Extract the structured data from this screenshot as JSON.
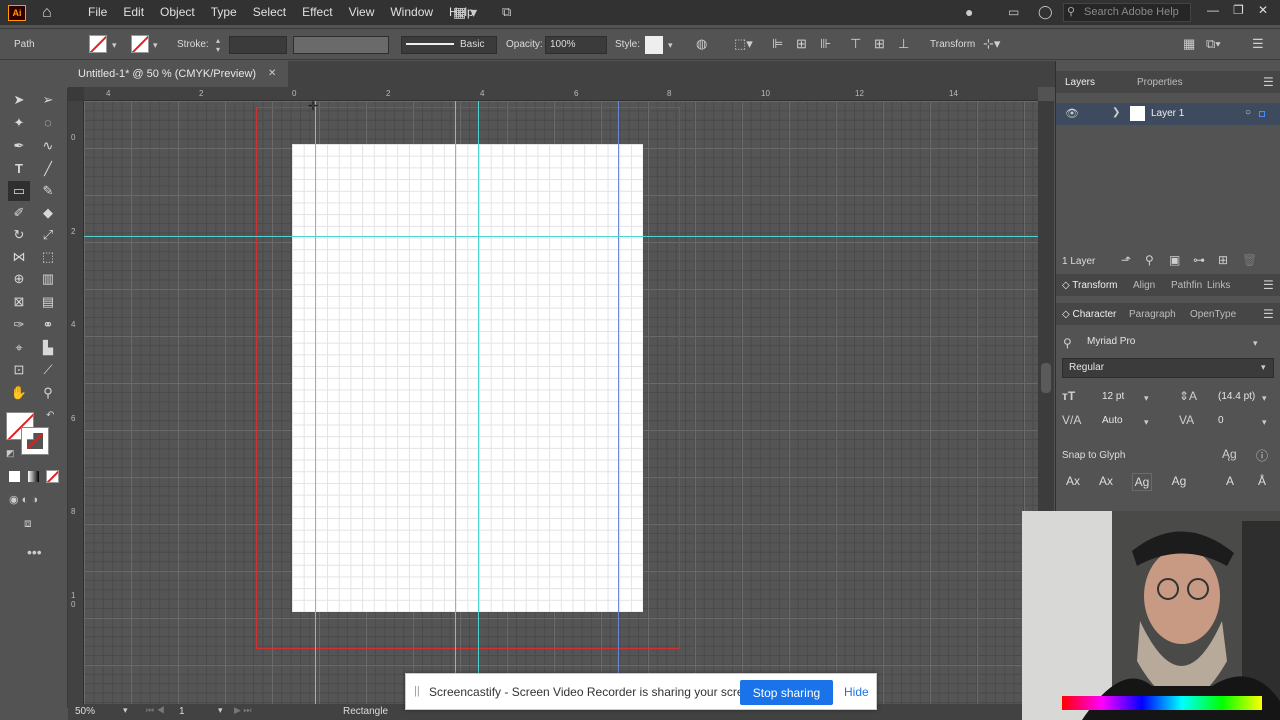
{
  "menubar": {
    "logo": "Ai",
    "items": [
      "File",
      "Edit",
      "Object",
      "Type",
      "Select",
      "Effect",
      "View",
      "Window",
      "Help"
    ],
    "search_placeholder": "Search Adobe Help"
  },
  "controlbar": {
    "selection_type": "Path",
    "stroke_label": "Stroke:",
    "brush_label": "Basic",
    "opacity_label": "Opacity:",
    "opacity_value": "100%",
    "style_label": "Style:",
    "transform_label": "Transform"
  },
  "document": {
    "tab_title": "Untitled-1* @ 50 % (CMYK/Preview)",
    "zoom": "50%",
    "artboard_num": "1",
    "status_tool": "Rectangle"
  },
  "ruler": {
    "top_ticks": [
      {
        "label": "4"
      },
      {
        "label": "2"
      },
      {
        "label": "0"
      },
      {
        "label": "2"
      },
      {
        "label": "4"
      },
      {
        "label": "6"
      },
      {
        "label": "8"
      },
      {
        "label": "10"
      },
      {
        "label": "12"
      },
      {
        "label": "14"
      }
    ],
    "left_ticks": [
      "0",
      "2",
      "4",
      "6",
      "8",
      "1 0"
    ]
  },
  "panels": {
    "layers_tab": "Layers",
    "properties_tab": "Properties",
    "layer_name": "Layer 1",
    "layer_count": "1 Layer",
    "transform_tab": "Transform",
    "align_tab": "Align",
    "pathfinder_tab": "Pathfin",
    "links_tab": "Links",
    "character_tab": "Character",
    "paragraph_tab": "Paragraph",
    "opentype_tab": "OpenType",
    "font_family": "Myriad Pro",
    "font_style": "Regular",
    "font_size": "12 pt",
    "leading": "(14.4 pt)",
    "kerning": "Auto",
    "tracking": "0",
    "snap_label": "Snap to Glyph"
  },
  "share_banner": {
    "message": "Screencastify - Screen Video Recorder is sharing your screen.",
    "stop_button": "Stop sharing",
    "hide_link": "Hide"
  }
}
